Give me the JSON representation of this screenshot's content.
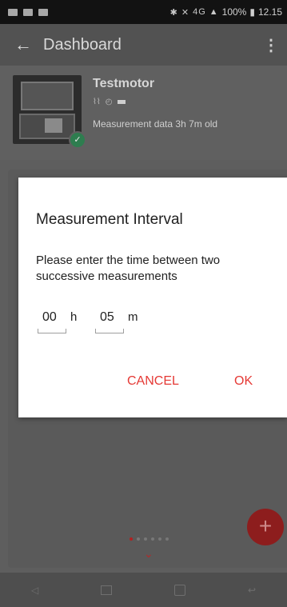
{
  "status_bar": {
    "time": "12.15",
    "battery": "100%",
    "network": "4G",
    "icons": [
      "bluetooth-icon",
      "mute-icon",
      "signal-icon"
    ]
  },
  "app_bar": {
    "title": "Dashboard"
  },
  "device": {
    "name": "Testmotor",
    "status": "Measurement data 3h 7m old",
    "connected": true
  },
  "dialog": {
    "title": "Measurement Interval",
    "message": "Please enter the time between two successive measurements",
    "hours_value": "00",
    "hours_unit": "h",
    "minutes_value": "05",
    "minutes_unit": "m",
    "cancel_label": "CANCEL",
    "ok_label": "OK"
  },
  "pager": {
    "pages": 6,
    "active": 0
  },
  "colors": {
    "accent": "#e53935",
    "success": "#2e7d4f"
  }
}
